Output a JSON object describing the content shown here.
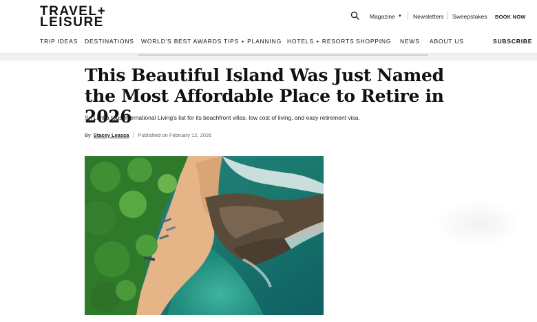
{
  "brand": {
    "logo_line1": "TRAVEL+",
    "logo_line2": "LEISURE"
  },
  "utility": {
    "search_icon": "search-icon",
    "magazine": "Magazine",
    "newsletters": "Newsletters",
    "sweepstakes": "Sweepstakes",
    "book_now": "BOOK NOW"
  },
  "nav": {
    "items": [
      "TRIP IDEAS",
      "DESTINATIONS",
      "WORLD'S BEST AWARDS",
      "TIPS + PLANNING",
      "HOTELS + RESORTS",
      "SHOPPING",
      "NEWS",
      "ABOUT US"
    ],
    "subscribe": "SUBSCRIBE"
  },
  "article": {
    "headline": "This Beautiful Island Was Just Named the Most Affordable Place to Retire in 2026",
    "dek": "Sri Lanka tops International Living's list for its beachfront villas, low cost of living, and easy retirement visa.",
    "by": "By",
    "author": "Stacey Leasca",
    "published": "Published on February 12, 2026"
  },
  "colors": {
    "ocean": "#1f8a7a",
    "sand": "#e8b98a",
    "jungle": "#2f7a2a"
  }
}
